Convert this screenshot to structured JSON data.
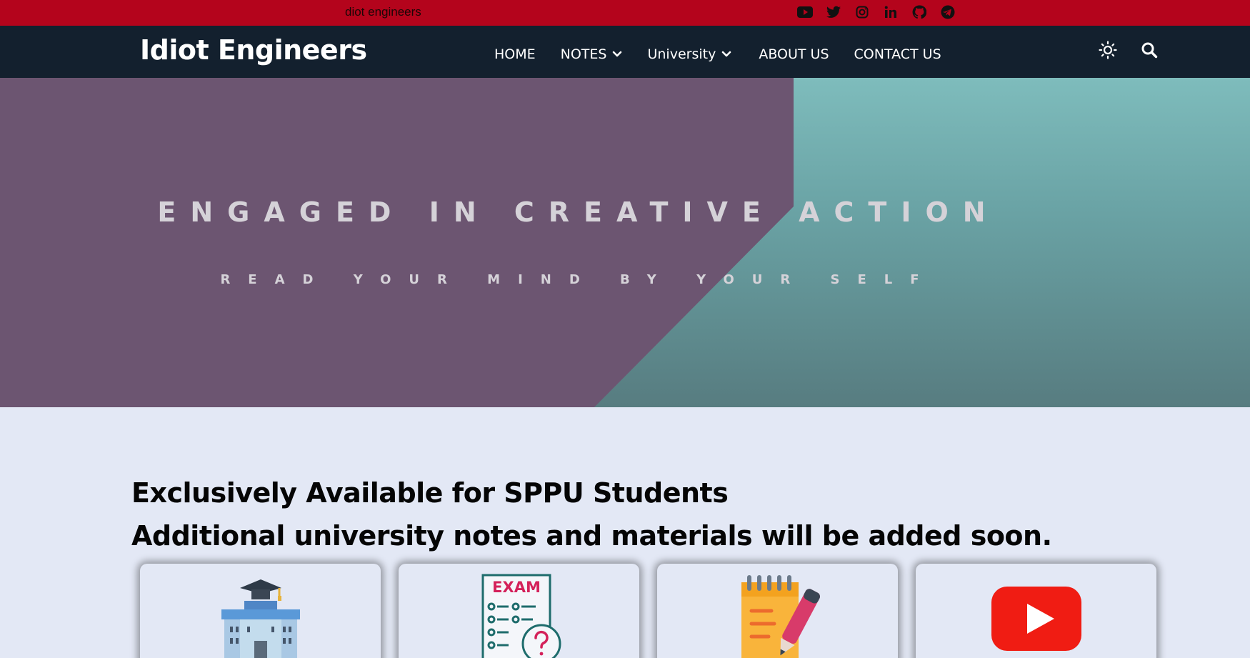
{
  "topbar": {
    "ticker": "diot engineers",
    "social": [
      "youtube-icon",
      "twitter-icon",
      "instagram-icon",
      "linkedin-icon",
      "github-icon",
      "telegram-icon"
    ]
  },
  "nav": {
    "brand": "Idiot Engineers",
    "items": [
      {
        "label": "HOME",
        "dropdown": false
      },
      {
        "label": "NOTES",
        "dropdown": true
      },
      {
        "label": "University",
        "dropdown": true
      },
      {
        "label": "ABOUT US",
        "dropdown": false
      },
      {
        "label": "CONTACT US",
        "dropdown": false
      }
    ],
    "tools": [
      "theme-toggle-icon",
      "search-icon"
    ]
  },
  "hero": {
    "title": "ENGAGED IN CREATIVE ACTION",
    "subtitle": "READ YOUR MIND BY YOUR SELF"
  },
  "content": {
    "headline_1": "Exclusively Available for SPPU Students",
    "headline_2": "Additional university notes and materials will be added soon."
  },
  "cards": [
    {
      "icon": "university-building-icon"
    },
    {
      "icon": "exam-paper-icon",
      "icon_text": "EXAM"
    },
    {
      "icon": "notepad-pen-icon"
    },
    {
      "icon": "youtube-play-icon"
    }
  ],
  "colors": {
    "topbar": "#b4041c",
    "navbar": "#13202e",
    "hero_purple": "#6c5571",
    "hero_teal": "#6aa3a5",
    "page_bg": "#e3e8f5",
    "youtube_red": "#f01c13"
  }
}
